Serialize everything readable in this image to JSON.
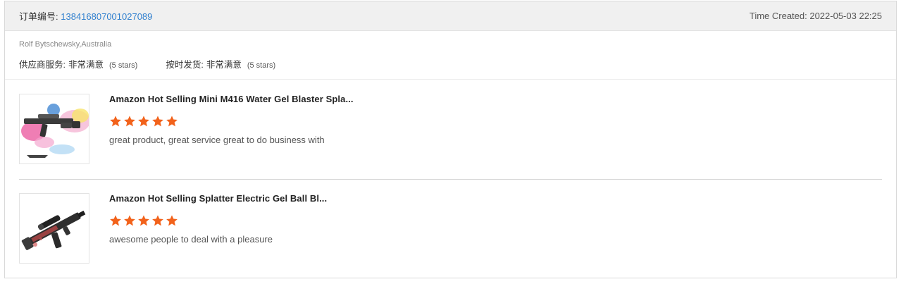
{
  "order": {
    "label": "订单编号:",
    "number": "138416807001027089",
    "time_created": "Time Created: 2022-05-03 22:25"
  },
  "buyer": {
    "name": "Rolf Bytschewsky,Australia",
    "ratings": [
      {
        "label": "供应商服务:",
        "value": "非常满意",
        "stars_text": "(5 stars)"
      },
      {
        "label": "按时发货:",
        "value": "非常满意",
        "stars_text": "(5 stars)"
      }
    ]
  },
  "items": [
    {
      "title": "Amazon Hot Selling Mini M416 Water Gel Blaster Spla...",
      "rating": 5,
      "comment": "great product, great service great to do business with",
      "thumb_icon": "gel-blaster-splash-image"
    },
    {
      "title": "Amazon Hot Selling Splatter Electric Gel Ball Bl...",
      "rating": 5,
      "comment": "awesome people to deal with a pleasure",
      "thumb_icon": "gel-rifle-image"
    }
  ],
  "colors": {
    "link": "#2f7fce",
    "star": "#f2621b",
    "header_bg": "#f0f0f0"
  }
}
